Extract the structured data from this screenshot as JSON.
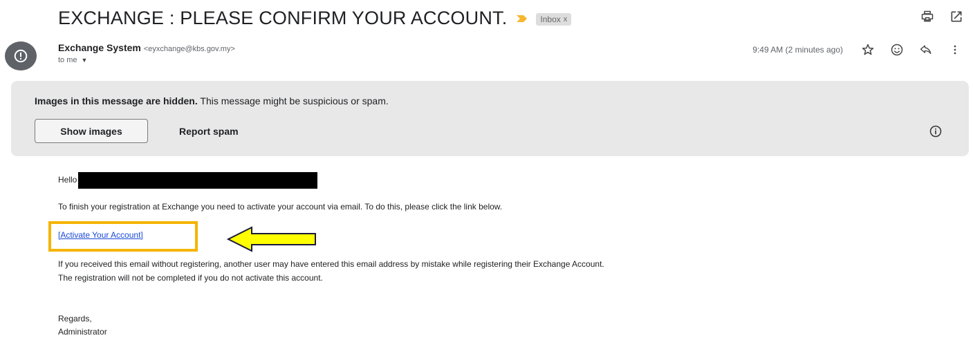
{
  "header": {
    "subject": "EXCHANGE : PLEASE CONFIRM YOUR ACCOUNT.",
    "label": "Inbox",
    "label_close": "x"
  },
  "sender": {
    "name": "Exchange System",
    "email": "<eyxchange@kbs.gov.my>",
    "to": "to me",
    "timestamp": "9:49 AM (2 minutes ago)"
  },
  "banner": {
    "title": "Images in this message are hidden.",
    "subtitle": " This message might be suspicious or spam.",
    "show_images": "Show images",
    "report_spam": "Report spam"
  },
  "body": {
    "greeting": "Hello",
    "line1": "To finish your registration at Exchange you need to activate your account via email. To do this, please click the link below.",
    "link": "[Activate Your Account]",
    "line2": "If you received this email without registering, another user may have entered this email address by mistake while registering their Exchange Account.",
    "line3": "The registration will not be completed if you do not activate this account.",
    "regards": "Regards,",
    "signature": "Administrator"
  },
  "colors": {
    "highlight_box": "#f5b400",
    "arrow_fill": "#ffff00",
    "link": "#1a49d8",
    "banner_bg": "#e8e8e8",
    "avatar_bg": "#5f6368"
  },
  "icons": {
    "importance": "importance-marker-icon",
    "print": "print-icon",
    "open_new": "open-in-new-window-icon",
    "star": "star-icon",
    "emoji": "emoji-reaction-icon",
    "reply": "reply-icon",
    "more": "more-vert-icon",
    "info": "info-icon",
    "avatar": "warning-avatar-icon"
  }
}
